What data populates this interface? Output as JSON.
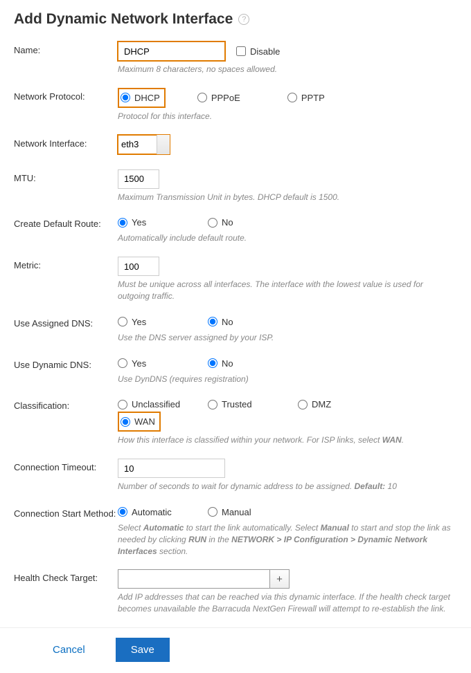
{
  "title": "Add Dynamic Network Interface",
  "fields": {
    "name": {
      "label": "Name:",
      "value": "DHCP",
      "disable_label": "Disable",
      "hint": "Maximum 8 characters, no spaces allowed."
    },
    "protocol": {
      "label": "Network Protocol:",
      "options": {
        "dhcp": "DHCP",
        "pppoe": "PPPoE",
        "pptp": "PPTP"
      },
      "selected": "dhcp",
      "hint": "Protocol for this interface."
    },
    "interface": {
      "label": "Network Interface:",
      "value": "eth3"
    },
    "mtu": {
      "label": "MTU:",
      "value": "1500",
      "hint": "Maximum Transmission Unit in bytes. DHCP default is 1500."
    },
    "default_route": {
      "label": "Create Default Route:",
      "yes": "Yes",
      "no": "No",
      "selected": "yes",
      "hint": "Automatically include default route."
    },
    "metric": {
      "label": "Metric:",
      "value": "100",
      "hint": "Must be unique across all interfaces. The interface with the lowest value is used for outgoing traffic."
    },
    "assigned_dns": {
      "label": "Use Assigned DNS:",
      "yes": "Yes",
      "no": "No",
      "selected": "no",
      "hint": "Use the DNS server assigned by your ISP."
    },
    "dynamic_dns": {
      "label": "Use Dynamic DNS:",
      "yes": "Yes",
      "no": "No",
      "selected": "no",
      "hint": "Use DynDNS (requires registration)"
    },
    "classification": {
      "label": "Classification:",
      "options": {
        "unclassified": "Unclassified",
        "trusted": "Trusted",
        "dmz": "DMZ",
        "wan": "WAN"
      },
      "selected": "wan",
      "hint_pre": "How this interface is classified within your network. For ISP links, select ",
      "hint_bold": "WAN",
      "hint_post": "."
    },
    "timeout": {
      "label": "Connection Timeout:",
      "value": "10",
      "hint_pre": "Number of seconds to wait for dynamic address to be assigned. ",
      "hint_bold": "Default:",
      "hint_post": " 10"
    },
    "start_method": {
      "label": "Connection Start Method:",
      "auto": "Automatic",
      "manual": "Manual",
      "selected": "auto",
      "hint_p1": "Select ",
      "hint_b1": "Automatic",
      "hint_p2": " to start the link automatically. Select ",
      "hint_b2": "Manual",
      "hint_p3": " to start and stop the link as needed by clicking ",
      "hint_b3": "RUN",
      "hint_p4": " in the ",
      "hint_b4": "NETWORK > IP Configuration > Dynamic Network Interfaces",
      "hint_p5": " section."
    },
    "health": {
      "label": "Health Check Target:",
      "add": "+",
      "hint": "Add IP addresses that can be reached via this dynamic interface. If the health check target becomes unavailable the Barracuda NextGen Firewall will attempt to re-establish the link."
    }
  },
  "footer": {
    "cancel": "Cancel",
    "save": "Save"
  }
}
